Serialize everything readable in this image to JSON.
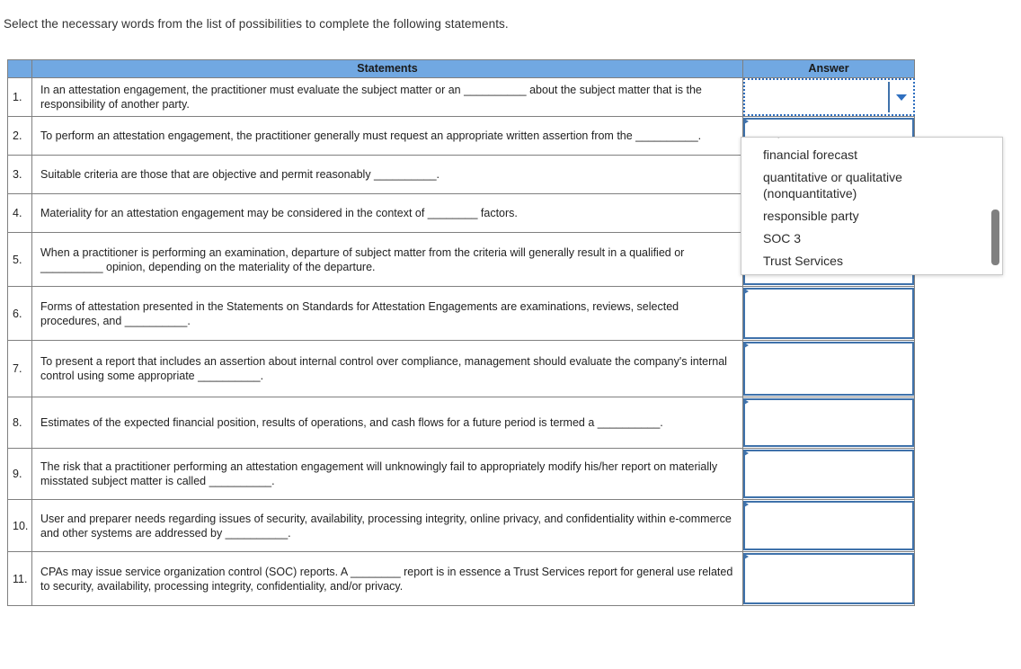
{
  "instructions": "Select the necessary words from the list of possibilities to complete the following statements.",
  "table": {
    "headers": {
      "number": "",
      "statements": "Statements",
      "answer": "Answer"
    },
    "rows": [
      {
        "num": "1.",
        "statement": "In an attestation engagement, the practitioner must evaluate the subject matter or an __________ about the subject matter that is the responsibility of another party.",
        "answer": ""
      },
      {
        "num": "2.",
        "statement": "To perform an attestation engagement, the practitioner generally must request an appropriate written assertion from the __________.",
        "answer": ""
      },
      {
        "num": "3.",
        "statement": "Suitable criteria are those that are objective and permit reasonably __________.",
        "answer": ""
      },
      {
        "num": "4.",
        "statement": "Materiality for an attestation engagement may be considered in the context of ________ factors.",
        "answer": ""
      },
      {
        "num": "5.",
        "statement": "When a practitioner is performing an examination, departure of subject matter from the criteria will generally result in a qualified or __________ opinion, depending on the materiality of the departure.",
        "answer": ""
      },
      {
        "num": "6.",
        "statement": "Forms of attestation presented in the Statements on Standards for Attestation Engagements are examinations, reviews, selected procedures, and __________.",
        "answer": ""
      },
      {
        "num": "7.",
        "statement": "To present a report that includes an assertion about internal control over compliance, management should evaluate the company's internal control using some appropriate __________.",
        "answer": ""
      },
      {
        "num": "8.",
        "statement": "Estimates of the expected financial position, results of operations, and cash flows for a future period is termed a __________.",
        "answer": ""
      },
      {
        "num": "9.",
        "statement": "The risk that a practitioner performing an attestation engagement will unknowingly fail to appropriately modify his/her report on materially misstated subject matter is called __________.",
        "answer": ""
      },
      {
        "num": "10.",
        "statement": "User and preparer needs regarding issues of security, availability, processing integrity, online privacy, and confidentiality within e-commerce and other systems are addressed by __________.",
        "answer": ""
      },
      {
        "num": "11.",
        "statement": "CPAs may issue service organization control (SOC) reports. A ________ report is in essence a Trust Services report for general use related to security, availability, processing integrity, confidentiality, and/or privacy.",
        "answer": ""
      }
    ]
  },
  "dropdown": {
    "open_for_row": 1,
    "selected_value": "",
    "options": [
      "financial forecast",
      "quantitative or qualitative\n(nonquantitative)",
      "responsible party",
      "SOC 3",
      "Trust Services"
    ]
  },
  "colors": {
    "header_blue": "#71a8e2",
    "answer_border_blue": "#3f72ab",
    "active_border_blue": "#2f6fbf",
    "grid_gray": "#808080"
  }
}
